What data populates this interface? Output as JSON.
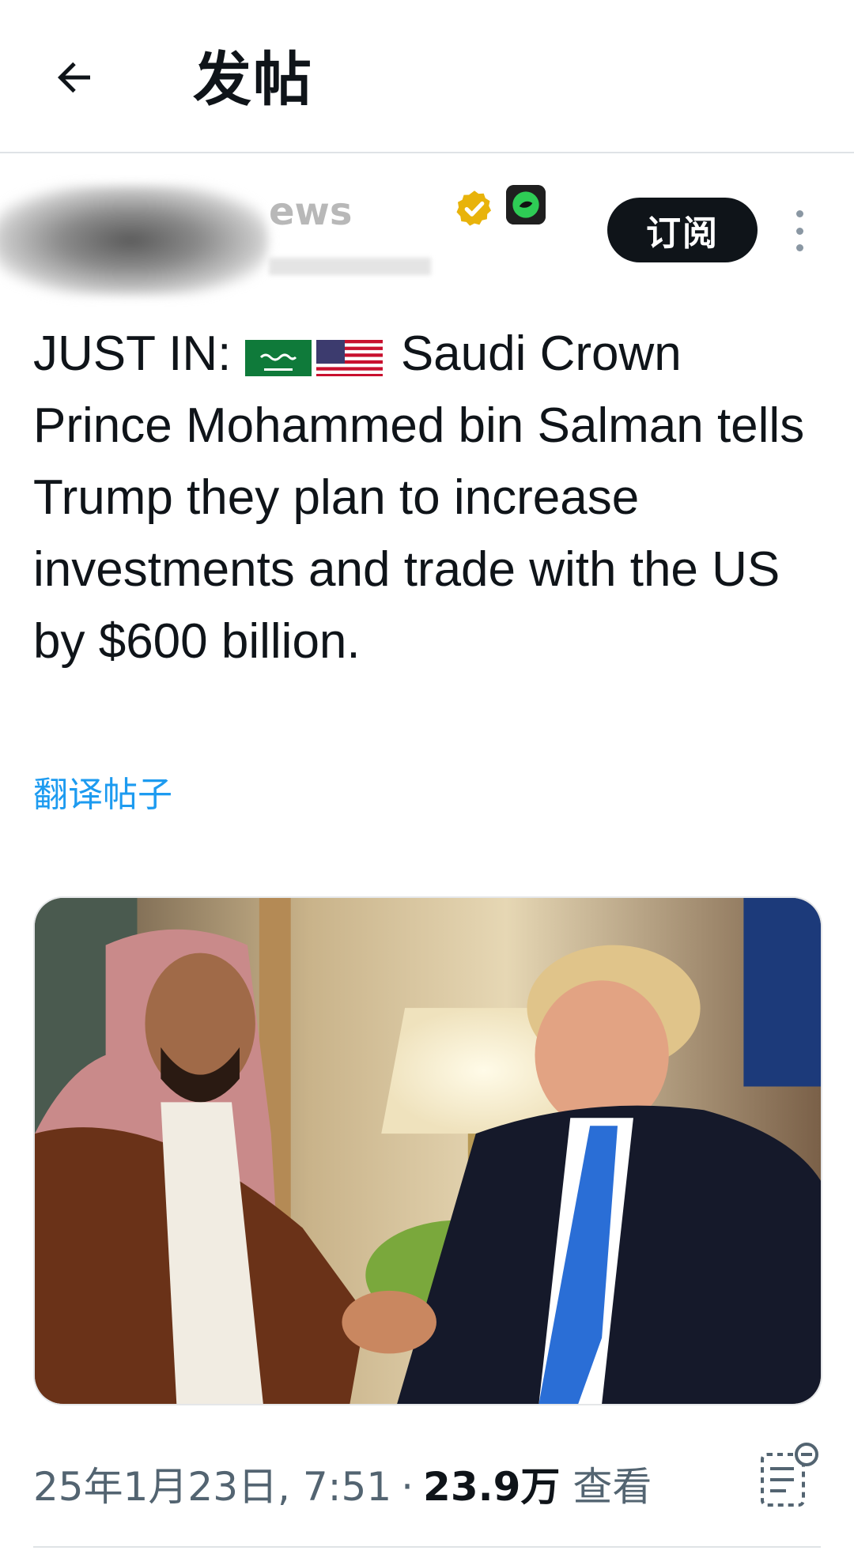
{
  "header": {
    "title": "发帖",
    "back_icon": "arrow-left-icon"
  },
  "author": {
    "handle_visible": "ews",
    "verified_color": "#e8b30b",
    "subscribe_label": "订阅",
    "more_icon": "more-vertical-icon"
  },
  "post": {
    "prefix": "JUST IN:",
    "flags": [
      "saudi-flag-icon",
      "us-flag-icon"
    ],
    "text": "Saudi Crown Prince Mohammed bin Salman tells Trump they plan to increase investments and trade with the US by $600 billion.",
    "translate_label": "翻译帖子"
  },
  "meta": {
    "date": "25年1月23日, 7:51",
    "separator": "·",
    "views": "23.9万",
    "views_label": "查看",
    "analytics_icon": "post-analytics-icon"
  },
  "colors": {
    "link": "#1d9bf0",
    "secondary_text": "#536471",
    "primary_text": "#0f1419"
  }
}
